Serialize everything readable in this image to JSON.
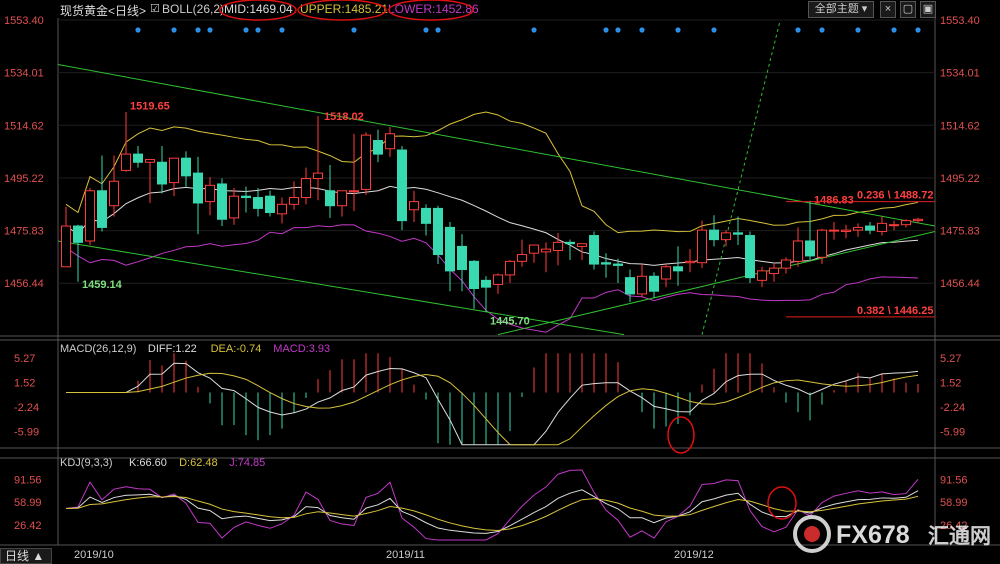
{
  "window": {
    "title": "现货黄金<日线>",
    "theme_select": "全部主题",
    "bottom_tab": "日线"
  },
  "colors": {
    "up": "#ff3b3b",
    "down": "#38d9b0",
    "mid": "#dcdcdc",
    "upper": "#d8c23a",
    "lower": "#c238c8",
    "channel": "#30c030",
    "dashed": "#30c030",
    "axis_text": "#e05050",
    "diff": "#dcdcdc",
    "dea": "#d8c23a",
    "kdj_k": "#dcdcdc",
    "kdj_d": "#d8c23a",
    "kdj_j": "#c238c8",
    "highlight": "#e01010"
  },
  "chart_data": [
    {
      "type": "candlestick",
      "title": "BOLL(26,2)",
      "legend": [
        {
          "label": "BOLL(26,2)",
          "color": "#cccccc"
        },
        {
          "label": "MID:1469.04",
          "color": "#dcdcdc"
        },
        {
          "label": "UPPER:1485.21",
          "color": "#d8c23a"
        },
        {
          "label": "LOWER:1452.86",
          "color": "#c238c8"
        }
      ],
      "y_ticks": [
        "1553.40",
        "1534.01",
        "1514.62",
        "1495.22",
        "1475.83",
        "1456.44"
      ],
      "y_tick_values": [
        1553.4,
        1534.01,
        1514.62,
        1495.22,
        1475.83,
        1456.44
      ],
      "ylim": [
        1437.0,
        1553.4
      ],
      "x_ticks": [
        "2019/10",
        "2019/11",
        "2019/12"
      ],
      "x_tick_index": [
        0,
        26,
        50
      ],
      "candles": [
        [
          1462.5,
          1484.5,
          1477.5,
          1462.5
        ],
        [
          1477.5,
          1478.0,
          1471.5,
          1457.0
        ],
        [
          1472.0,
          1491.5,
          1490.5,
          1470.5
        ],
        [
          1490.5,
          1503.5,
          1477.0,
          1475.5
        ],
        [
          1485.0,
          1503.5,
          1494.0,
          1481.0
        ],
        [
          1498.0,
          1519.5,
          1504.0,
          1497.5
        ],
        [
          1504.0,
          1507.0,
          1501.0,
          1499.0
        ],
        [
          1501.0,
          1502.0,
          1502.0,
          1486.0
        ],
        [
          1501.0,
          1507.0,
          1493.0,
          1489.5
        ],
        [
          1493.5,
          1502.5,
          1502.5,
          1488.5
        ],
        [
          1502.5,
          1505.0,
          1496.0,
          1492.0
        ],
        [
          1497.0,
          1503.0,
          1486.0,
          1474.5
        ],
        [
          1486.5,
          1495.5,
          1492.5,
          1481.5
        ],
        [
          1493.0,
          1495.0,
          1480.0,
          1477.5
        ],
        [
          1480.5,
          1491.5,
          1488.5,
          1478.0
        ],
        [
          1488.5,
          1492.0,
          1488.0,
          1482.5
        ],
        [
          1488.0,
          1491.5,
          1484.0,
          1481.0
        ],
        [
          1488.5,
          1490.5,
          1482.5,
          1481.0
        ],
        [
          1482.0,
          1488.0,
          1485.5,
          1478.5
        ],
        [
          1485.5,
          1494.0,
          1488.0,
          1483.5
        ],
        [
          1488.0,
          1499.0,
          1495.0,
          1485.5
        ],
        [
          1495.0,
          1518.0,
          1497.0,
          1487.0
        ],
        [
          1490.5,
          1500.0,
          1485.0,
          1480.5
        ],
        [
          1485.0,
          1490.5,
          1490.5,
          1481.0
        ],
        [
          1490.5,
          1511.5,
          1490.5,
          1483.0
        ],
        [
          1491.0,
          1512.0,
          1511.0,
          1489.0
        ],
        [
          1509.0,
          1513.0,
          1504.0,
          1501.0
        ],
        [
          1506.0,
          1514.0,
          1511.5,
          1503.0
        ],
        [
          1505.5,
          1507.0,
          1479.5,
          1476.0
        ],
        [
          1483.5,
          1490.5,
          1486.5,
          1479.0
        ],
        [
          1484.0,
          1485.5,
          1478.5,
          1474.0
        ],
        [
          1484.0,
          1485.0,
          1467.0,
          1463.5
        ],
        [
          1477.0,
          1479.0,
          1461.0,
          1453.5
        ],
        [
          1470.0,
          1474.5,
          1461.5,
          1453.5
        ],
        [
          1464.5,
          1465.0,
          1454.5,
          1447.0
        ],
        [
          1457.5,
          1459.0,
          1455.0,
          1445.8
        ],
        [
          1456.0,
          1460.0,
          1459.5,
          1452.5
        ],
        [
          1459.5,
          1465.0,
          1464.5,
          1456.5
        ],
        [
          1464.5,
          1472.5,
          1467.0,
          1462.5
        ],
        [
          1467.5,
          1469.5,
          1470.5,
          1464.0
        ],
        [
          1468.0,
          1471.5,
          1469.0,
          1460.5
        ],
        [
          1468.5,
          1475.0,
          1471.5,
          1463.0
        ],
        [
          1471.5,
          1472.5,
          1471.0,
          1465.0
        ],
        [
          1470.0,
          1471.0,
          1471.0,
          1465.0
        ],
        [
          1474.0,
          1475.5,
          1463.5,
          1461.5
        ],
        [
          1464.0,
          1467.5,
          1463.5,
          1458.5
        ],
        [
          1463.5,
          1465.5,
          1463.0,
          1456.5
        ],
        [
          1458.5,
          1461.5,
          1452.5,
          1449.5
        ],
        [
          1452.5,
          1463.5,
          1459.0,
          1451.5
        ],
        [
          1459.0,
          1460.5,
          1453.5,
          1451.0
        ],
        [
          1458.0,
          1463.5,
          1462.5,
          1455.0
        ],
        [
          1462.5,
          1470.0,
          1461.0,
          1455.5
        ],
        [
          1464.0,
          1469.0,
          1464.5,
          1460.5
        ],
        [
          1464.0,
          1479.5,
          1476.0,
          1462.0
        ],
        [
          1476.0,
          1481.5,
          1472.5,
          1470.0
        ],
        [
          1472.5,
          1476.0,
          1475.0,
          1470.0
        ],
        [
          1475.0,
          1481.0,
          1474.5,
          1470.5
        ],
        [
          1474.0,
          1475.5,
          1458.5,
          1456.5
        ],
        [
          1457.5,
          1462.5,
          1461.0,
          1455.0
        ],
        [
          1460.0,
          1463.5,
          1462.0,
          1457.0
        ],
        [
          1462.0,
          1466.0,
          1465.0,
          1460.0
        ],
        [
          1464.5,
          1477.0,
          1472.0,
          1462.5
        ],
        [
          1472.0,
          1486.8,
          1466.5,
          1465.0
        ],
        [
          1466.0,
          1476.5,
          1476.0,
          1463.5
        ],
        [
          1476.0,
          1479.0,
          1476.0,
          1472.5
        ],
        [
          1475.5,
          1478.0,
          1476.0,
          1473.0
        ],
        [
          1476.0,
          1478.5,
          1477.0,
          1473.5
        ],
        [
          1477.5,
          1479.0,
          1476.0,
          1474.5
        ],
        [
          1475.5,
          1481.0,
          1478.5,
          1474.0
        ],
        [
          1478.0,
          1479.5,
          1478.0,
          1476.0
        ],
        [
          1478.0,
          1480.0,
          1479.5,
          1477.0
        ],
        [
          1479.5,
          1480.5,
          1480.0,
          1478.5
        ]
      ],
      "annotations": [
        {
          "text": "1519.65",
          "x": 5,
          "y": 1519.65,
          "pos": "above"
        },
        {
          "text": "1518.02",
          "x": 21,
          "y": 1518.02,
          "pos": "right"
        },
        {
          "text": "1459.14",
          "x": 1,
          "y": 1459.14,
          "pos": "below"
        },
        {
          "text": "1445.70",
          "x": 35,
          "y": 1445.7,
          "pos": "below"
        },
        {
          "text": "1486.83",
          "x": 62,
          "y": 1486.83,
          "pos": "left"
        },
        {
          "text": "0.236 \\ 1488.72",
          "x": 67.5,
          "y": 1488.72,
          "pos": "level"
        },
        {
          "text": "0.382 \\ 1446.25",
          "x": 67.5,
          "y": 1446.25,
          "pos": "level"
        }
      ]
    },
    {
      "type": "bar",
      "title": "MACD(26,12,9)",
      "legend": [
        {
          "label": "MACD(26,12,9)",
          "color": "#cccccc"
        },
        {
          "label": "DIFF:1.22",
          "color": "#dcdcdc"
        },
        {
          "label": "DEA:-0.74",
          "color": "#d8c23a"
        },
        {
          "label": "MACD:3.93",
          "color": "#c238c8"
        }
      ],
      "y_ticks": [
        "5.27",
        "1.52",
        "-2.24",
        "-5.99"
      ],
      "y_tick_values": [
        5.27,
        1.52,
        -2.24,
        -5.99
      ],
      "ylim": [
        -8.5,
        6.5
      ]
    },
    {
      "type": "line",
      "title": "KDJ(9,3,3)",
      "legend": [
        {
          "label": "KDJ(9,3,3)",
          "color": "#cccccc"
        },
        {
          "label": "K:66.60",
          "color": "#dcdcdc"
        },
        {
          "label": "D:62.48",
          "color": "#d8c23a"
        },
        {
          "label": "J:74.85",
          "color": "#c238c8"
        }
      ],
      "y_ticks": [
        "91.56",
        "58.99",
        "26.42"
      ],
      "y_tick_values": [
        91.56,
        58.99,
        26.42
      ],
      "ylim": [
        5,
        112
      ]
    }
  ],
  "watermark": {
    "brand": "FX678",
    "cn": "汇通网"
  }
}
